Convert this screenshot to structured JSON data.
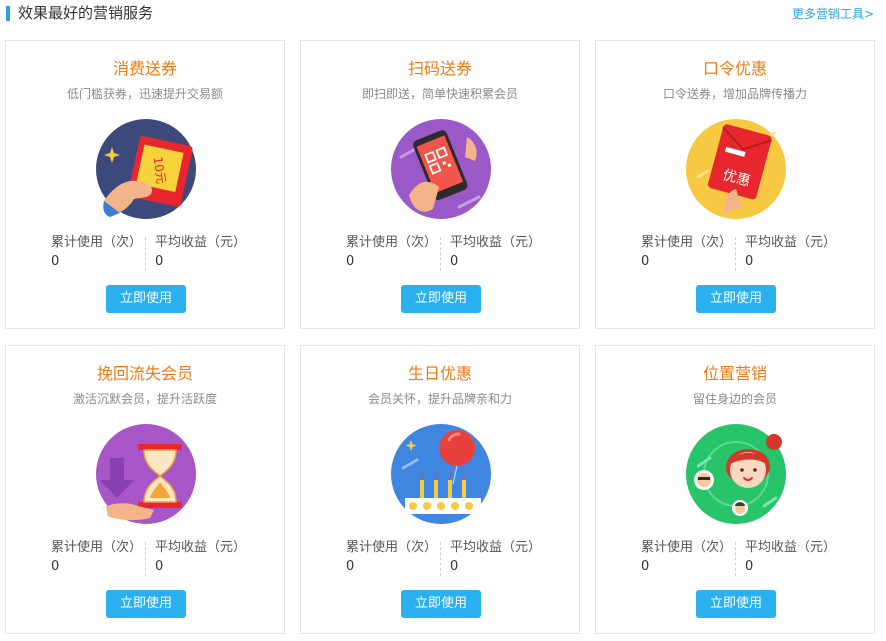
{
  "header": {
    "title": "效果最好的营销服务",
    "more_link": "更多营销工具>",
    "accent_color": "#2aa3e0"
  },
  "stat_labels": {
    "total_use": "累计使用（次）",
    "avg_income": "平均收益（元）"
  },
  "button_label": "立即使用",
  "colors": {
    "title": "#f07b14",
    "button": "#2ab0ef"
  },
  "cards": [
    {
      "title": "消费送券",
      "subtitle": "低门槛获券，迅速提升交易额",
      "icon": "coupon-hand-icon",
      "illustration_text": "10元",
      "total_use": "0",
      "avg_income": "0"
    },
    {
      "title": "扫码送券",
      "subtitle": "即扫即送，简单快速积累会员",
      "icon": "scan-phone-icon",
      "total_use": "0",
      "avg_income": "0"
    },
    {
      "title": "口令优惠",
      "subtitle": "口令送券，增加品牌传播力",
      "icon": "red-envelope-icon",
      "illustration_text": "优惠",
      "total_use": "0",
      "avg_income": "0"
    },
    {
      "title": "挽回流失会员",
      "subtitle": "激活沉默会员，提升活跃度",
      "icon": "hourglass-icon",
      "total_use": "0",
      "avg_income": "0"
    },
    {
      "title": "生日优惠",
      "subtitle": "会员关怀，提升品牌亲和力",
      "icon": "birthday-cake-icon",
      "total_use": "0",
      "avg_income": "0"
    },
    {
      "title": "位置营销",
      "subtitle": "留住身边的会员",
      "icon": "location-people-icon",
      "total_use": "0",
      "avg_income": "0"
    }
  ]
}
